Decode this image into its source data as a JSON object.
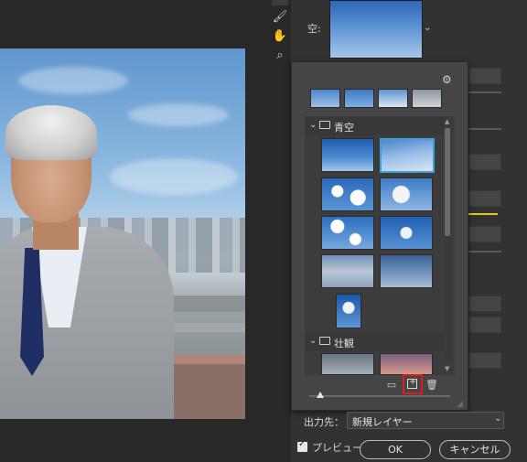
{
  "tools": {
    "brush_icon": "brush-icon",
    "hand_icon": "hand-icon",
    "zoom_icon": "zoom-icon"
  },
  "sky_panel": {
    "label": "空:",
    "dropdown_caret": "⌄"
  },
  "sky_picker": {
    "gear_icon": "⚙",
    "groups": [
      {
        "name": "青空",
        "expanded": true
      },
      {
        "name": "壮観",
        "expanded": true
      }
    ],
    "selected_thumbnail_index": 2,
    "footer": {
      "new_group_icon": "folder-icon",
      "add_icon": "add-sky-icon",
      "delete_icon": "trash-icon"
    },
    "size_slider": 0.08
  },
  "output": {
    "label": "出力先：",
    "value": "新規レイヤー"
  },
  "preview": {
    "label": "プレビュー",
    "checked": true
  },
  "buttons": {
    "ok": "OK",
    "cancel": "キャンセル"
  },
  "colors": {
    "selection": "#37a2dd",
    "highlight_box": "#e01b1b",
    "accent_line": "#e8c800"
  }
}
